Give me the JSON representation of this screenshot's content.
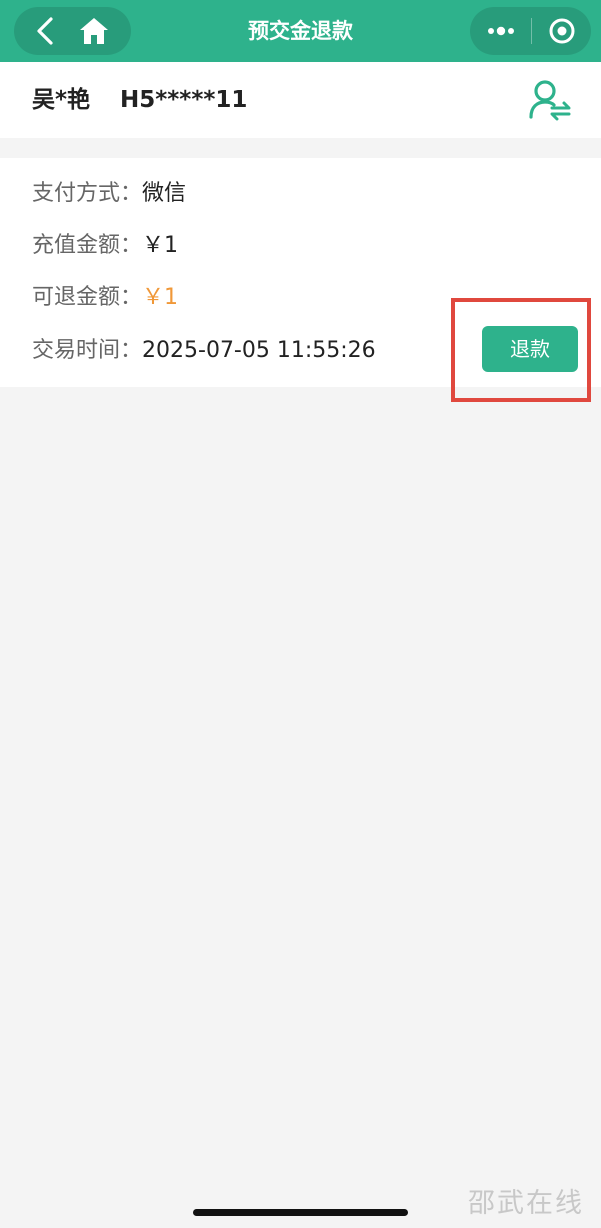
{
  "navbar": {
    "title": "预交金退款",
    "back_icon": "chevron-left-icon",
    "home_icon": "home-icon",
    "more_icon": "more-dots-icon",
    "close_icon": "target-close-icon",
    "background": "#2eb28c"
  },
  "patient": {
    "name": "吴*艳",
    "id": "H5*****11",
    "switch_icon": "switch-patient-icon"
  },
  "record": {
    "payment_method_label": "支付方式：",
    "payment_method": "微信",
    "recharge_amount_label": "充值金额：",
    "recharge_amount": "￥1",
    "refundable_amount_label": "可退金额：",
    "refundable_amount": "￥1",
    "trade_time_label": "交易时间：",
    "trade_time": "2025-07-05 11:55:26",
    "refund_button": "退款"
  },
  "colors": {
    "accent": "#2eb28c",
    "amount_highlight": "#f09838",
    "annotation": "#e0483e"
  },
  "watermark": "邵武在线"
}
